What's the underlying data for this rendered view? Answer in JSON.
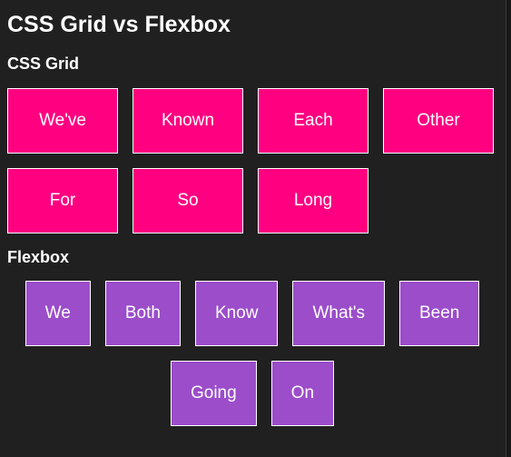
{
  "title": "CSS Grid vs Flexbox",
  "grid_section": {
    "heading": "CSS Grid",
    "items": [
      "We've",
      "Known",
      "Each",
      "Other",
      "For",
      "So",
      "Long"
    ]
  },
  "flex_section": {
    "heading": "Flexbox",
    "items": [
      "We",
      "Both",
      "Know",
      "What's",
      "Been",
      "Going",
      "On"
    ]
  },
  "colors": {
    "background": "#202020",
    "grid_item": "#ff0080",
    "flex_item": "#9b4dca",
    "text": "#ffffff"
  }
}
